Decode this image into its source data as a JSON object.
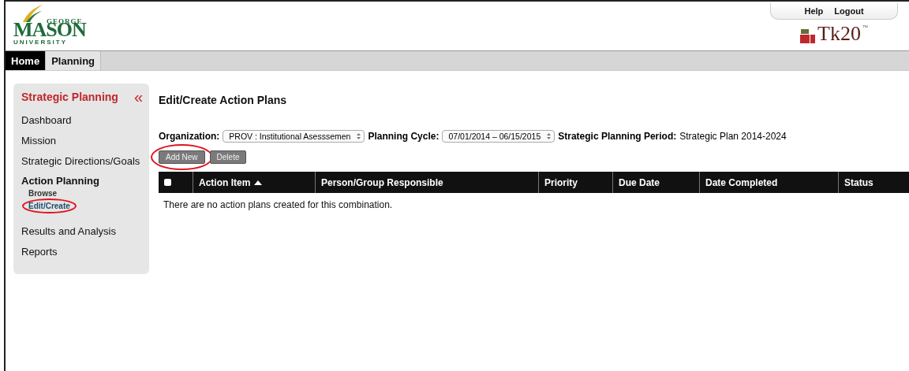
{
  "header": {
    "logo": {
      "top": "GEORGE",
      "main": "MASON",
      "bottom": "UNIVERSITY"
    },
    "links": [
      "Help",
      "Logout"
    ],
    "brand": {
      "name": "Tk20",
      "mark": "™"
    }
  },
  "tabs": [
    {
      "label": "Home",
      "selected": true
    },
    {
      "label": "Planning",
      "selected": false
    }
  ],
  "sidebar": {
    "title": "Strategic Planning",
    "collapse": "«",
    "items": [
      {
        "label": "Dashboard",
        "kind": "link",
        "selected": false
      },
      {
        "label": "Mission",
        "kind": "link",
        "selected": false
      },
      {
        "label": "Strategic Directions/Goals",
        "kind": "link",
        "selected": false
      },
      {
        "label": "Action Planning",
        "kind": "heading",
        "children": [
          {
            "label": "Browse",
            "selected": false,
            "circled": false
          },
          {
            "label": "Edit/Create",
            "selected": true,
            "circled": true
          }
        ]
      },
      {
        "label": "Results and Analysis",
        "kind": "link",
        "selected": false
      },
      {
        "label": "Reports",
        "kind": "link",
        "selected": false
      }
    ]
  },
  "main": {
    "title": "Edit/Create Action Plans",
    "filters": {
      "organization_label": "Organization:",
      "organization": "PROV : Institutional Asesssemen",
      "cycle_label": "Planning Cycle:",
      "cycle": "07/01/2014 – 06/15/2015",
      "period_label": "Strategic Planning Period:",
      "period": "Strategic Plan 2014-2024"
    },
    "buttons": [
      {
        "label": "Add New",
        "circled": true
      },
      {
        "label": "Delete",
        "circled": false
      }
    ],
    "table": {
      "select_all": {
        "checked": false
      },
      "columns": [
        {
          "label": "Action Item",
          "sorted": true
        },
        {
          "label": "Person/Group Responsible",
          "sorted": false
        },
        {
          "label": "Priority",
          "sorted": false
        },
        {
          "label": "Due Date",
          "sorted": false
        },
        {
          "label": "Date Completed",
          "sorted": false
        },
        {
          "label": "Status",
          "sorted": false
        }
      ],
      "empty_message": "There are no action plans created for this combination."
    }
  }
}
